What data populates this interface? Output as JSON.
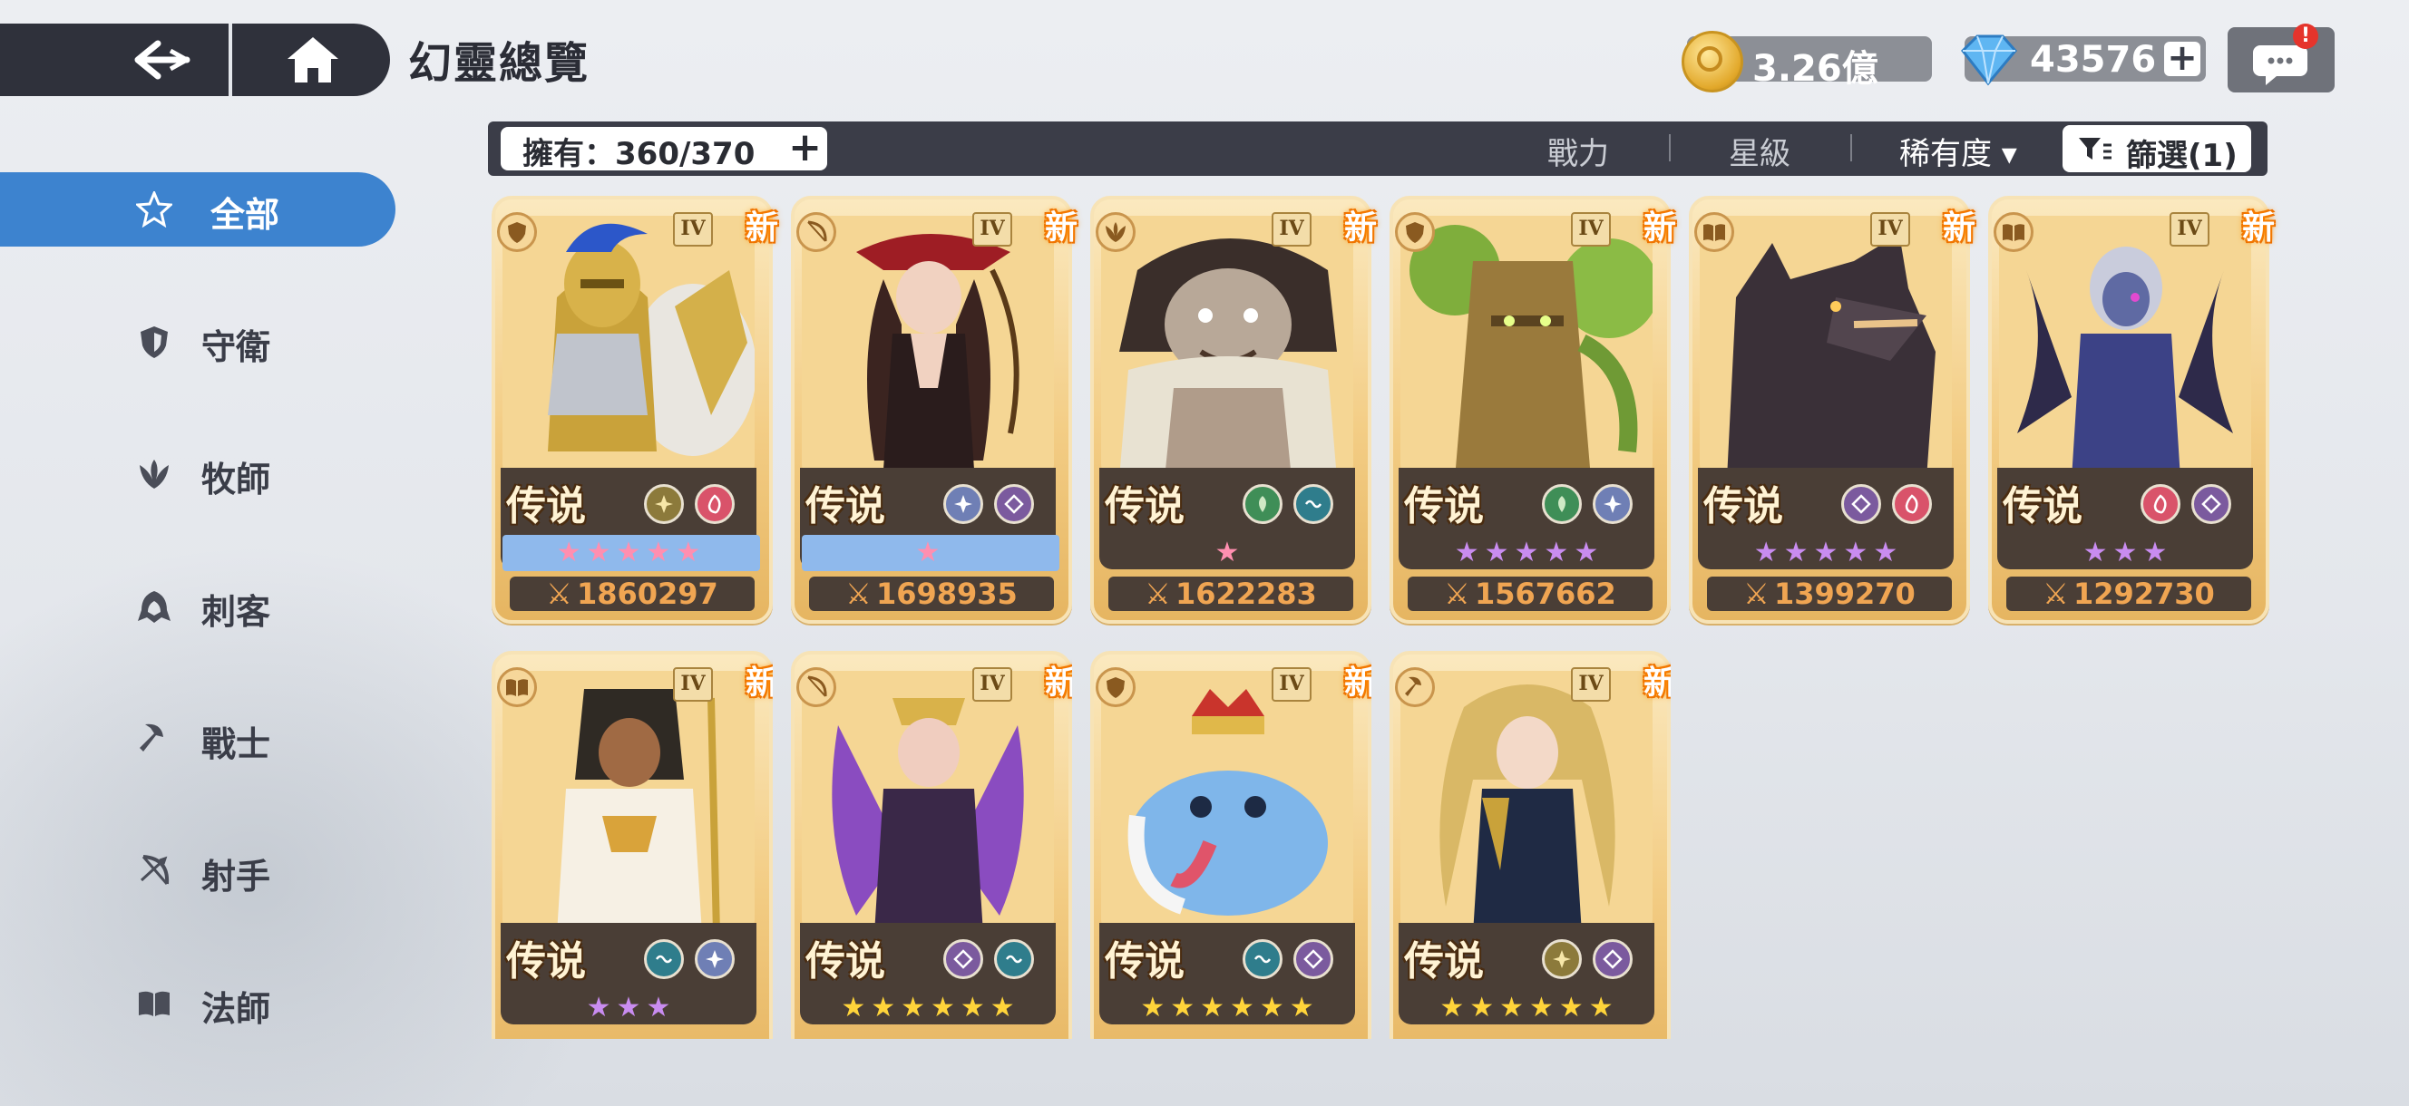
{
  "header": {
    "title": "幻靈總覽",
    "gold": "3.26億",
    "gems": "43576",
    "plus": "+",
    "chat_badge": "!"
  },
  "sidebar": {
    "items": [
      {
        "label": "全部",
        "icon": "all-star-icon",
        "active": true
      },
      {
        "label": "守衛",
        "icon": "shield-icon"
      },
      {
        "label": "牧師",
        "icon": "wing-icon"
      },
      {
        "label": "刺客",
        "icon": "hood-icon"
      },
      {
        "label": "戰士",
        "icon": "axe-icon"
      },
      {
        "label": "射手",
        "icon": "bow-icon"
      },
      {
        "label": "法師",
        "icon": "book-icon"
      }
    ]
  },
  "filter_bar": {
    "owned": "擁有：360/370",
    "sort_power": "戰力",
    "sort_star": "星級",
    "sort_rarity": "稀有度 ▾",
    "filter": "篩選(1)"
  },
  "cards": [
    {
      "class_icon": "guardian-icon",
      "tier": "IV",
      "new": "新",
      "rarity": "传说",
      "elements": [
        "light",
        "fire"
      ],
      "stars": "★★★★★",
      "star_color": "pink",
      "star_bg": true,
      "power": "1860297"
    },
    {
      "class_icon": "archer-icon",
      "tier": "IV",
      "new": "新",
      "rarity": "传说",
      "elements": [
        "light",
        "dark"
      ],
      "stars": "★",
      "star_color": "pink",
      "star_bg": true,
      "power": "1698935"
    },
    {
      "class_icon": "priest-icon",
      "tier": "IV",
      "new": "新",
      "rarity": "传说",
      "elements": [
        "earth",
        "water"
      ],
      "stars": "★",
      "star_color": "pink",
      "star_bg": false,
      "power": "1622283"
    },
    {
      "class_icon": "guardian-icon",
      "tier": "IV",
      "new": "新",
      "rarity": "传说",
      "elements": [
        "earth",
        "light"
      ],
      "stars": "★★★★★",
      "star_color": "purple",
      "star_bg": false,
      "power": "1567662"
    },
    {
      "class_icon": "mage-icon",
      "tier": "IV",
      "new": "新",
      "rarity": "传说",
      "elements": [
        "dark",
        "fire"
      ],
      "stars": "★★★★★",
      "star_color": "purple",
      "star_bg": false,
      "power": "1399270"
    },
    {
      "class_icon": "mage-icon",
      "tier": "IV",
      "new": "新",
      "rarity": "传说",
      "elements": [
        "fire",
        "dark"
      ],
      "stars": "★★★",
      "star_color": "purple",
      "star_bg": false,
      "power": "1292730"
    },
    {
      "class_icon": "mage-icon",
      "tier": "IV",
      "new": "新",
      "rarity": "传说",
      "elements": [
        "water",
        "light"
      ],
      "stars": "★★★",
      "star_color": "purple",
      "star_bg": false,
      "power": ""
    },
    {
      "class_icon": "archer-icon",
      "tier": "IV",
      "new": "新",
      "rarity": "传说",
      "elements": [
        "dark",
        "water"
      ],
      "stars": "★★★★★★",
      "star_color": "gold",
      "star_bg": false,
      "power": ""
    },
    {
      "class_icon": "guardian-icon",
      "tier": "IV",
      "new": "新",
      "rarity": "传说",
      "elements": [
        "water",
        "dark"
      ],
      "stars": "★★★★★★",
      "star_color": "gold",
      "star_bg": false,
      "power": ""
    },
    {
      "class_icon": "warrior-icon",
      "tier": "IV",
      "new": "新",
      "rarity": "传说",
      "elements": [
        "wind",
        "dark"
      ],
      "stars": "★★★★★★",
      "star_color": "gold",
      "star_bg": false,
      "power": ""
    }
  ],
  "colors": {
    "accent_blue": "#3d83cf",
    "dark_bar": "#3b3d48",
    "card_gold": "#f3cd85",
    "power_orange": "#f0a552",
    "new_badge_orange": "#ff7a00"
  }
}
